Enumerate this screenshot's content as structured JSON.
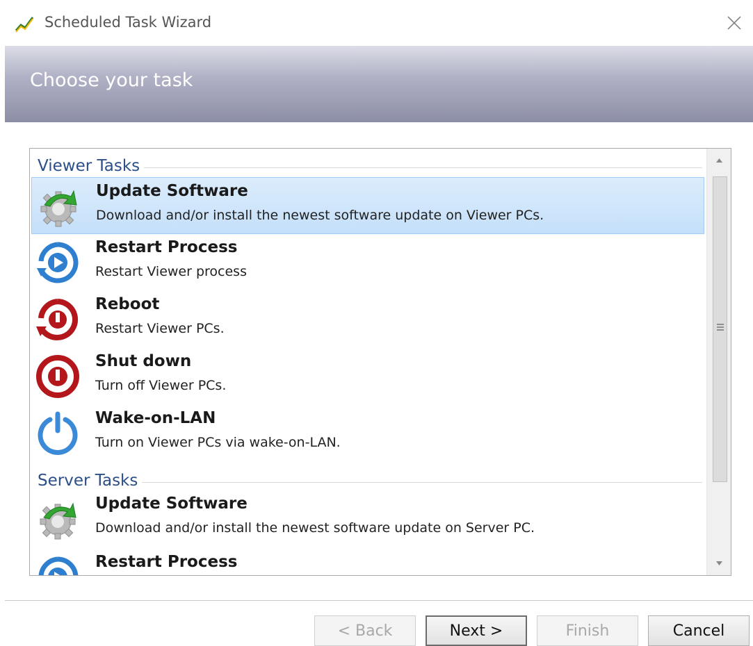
{
  "window": {
    "title": "Scheduled Task Wizard",
    "close_icon": "close-icon",
    "app_icon": "chart-line-icon"
  },
  "banner": {
    "title": "Choose your task"
  },
  "groups": [
    {
      "label": "Viewer Tasks",
      "items": [
        {
          "title": "Update Software",
          "description": "Download and/or install the newest software update on Viewer PCs.",
          "icon": "update-gear-icon",
          "selected": true
        },
        {
          "title": "Restart Process",
          "description": "Restart Viewer process",
          "icon": "restart-process-icon",
          "selected": false
        },
        {
          "title": "Reboot",
          "description": "Restart Viewer PCs.",
          "icon": "reboot-icon",
          "selected": false
        },
        {
          "title": "Shut down",
          "description": "Turn off Viewer PCs.",
          "icon": "shutdown-icon",
          "selected": false
        },
        {
          "title": "Wake-on-LAN",
          "description": "Turn on Viewer PCs via wake-on-LAN.",
          "icon": "power-icon",
          "selected": false
        }
      ]
    },
    {
      "label": "Server Tasks",
      "items": [
        {
          "title": "Update Software",
          "description": "Download and/or install the newest software update on Server PC.",
          "icon": "update-gear-icon",
          "selected": false
        },
        {
          "title": "Restart Process",
          "description": "",
          "icon": "restart-process-icon",
          "selected": false
        }
      ]
    }
  ],
  "buttons": {
    "back": "< Back",
    "next": "Next >",
    "finish": "Finish",
    "cancel": "Cancel"
  },
  "colors": {
    "group_header": "#2d4f88",
    "selection": "#c4e0fa",
    "reboot_red": "#b3171c",
    "restart_blue": "#2f7fd0"
  }
}
